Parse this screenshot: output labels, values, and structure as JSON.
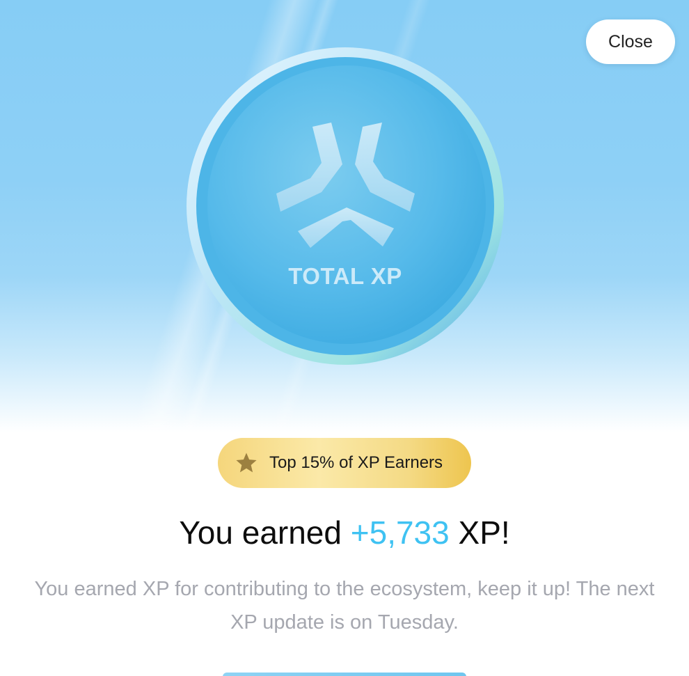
{
  "close_button": {
    "label": "Close"
  },
  "coin": {
    "label": "TOTAL XP"
  },
  "badge": {
    "icon": "star-icon",
    "label": "Top 15% of XP Earners"
  },
  "headline": {
    "prefix": "You earned ",
    "amount": "+5,733",
    "suffix": " XP!"
  },
  "description": "You earned XP for contributing to the ecosystem, keep it up! The next XP update is on Tuesday.",
  "colors": {
    "accent_blue": "#3fc2f2",
    "hero_sky": "#8ed0f6",
    "badge_gold": "#f4da85",
    "muted_text": "#a5a7af"
  }
}
